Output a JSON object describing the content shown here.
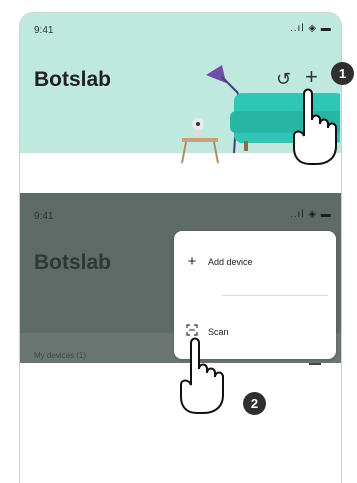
{
  "screen1": {
    "time": "9:41",
    "status_icons": "..ıl ◈ ▬",
    "app_title": "Botslab",
    "refresh_icon": "↺",
    "add_icon": "+"
  },
  "screen2": {
    "time": "9:41",
    "status_icons": "..ıl ◈ ▬",
    "app_title": "Botslab",
    "menu": {
      "add_device": "Add device",
      "scan": "Scan"
    },
    "devices_label": "My devices  (1)"
  },
  "steps": [
    "1",
    "2"
  ],
  "colors": {
    "mint": "#bfe9de",
    "dim": "#5e6b67",
    "badge": "#2f2f2f"
  }
}
